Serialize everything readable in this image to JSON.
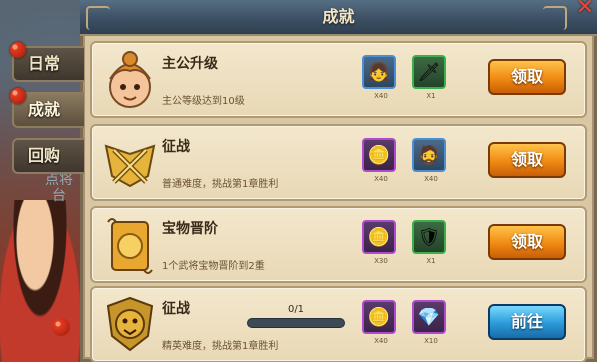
{
  "window": {
    "title": "成就",
    "close_glyph": "✕"
  },
  "tabs": [
    {
      "label": "日常",
      "badge": true
    },
    {
      "label": "成就",
      "badge": true,
      "active": true
    },
    {
      "label": "回购",
      "badge": false
    }
  ],
  "scene": {
    "sign_text": "点将台"
  },
  "achievements": [
    {
      "title": "主公升级",
      "desc": "主公等级达到10级",
      "icon": "lord-portrait-icon",
      "rewards": [
        {
          "icon": "hero-girl-card-icon",
          "glyph": "👧",
          "count": "X40"
        },
        {
          "icon": "sword-icon",
          "glyph": "🗡",
          "count": "X1"
        }
      ],
      "button": "领取",
      "button_style": "orange"
    },
    {
      "title": "征战",
      "desc": "普通难度，挑战第1章胜利",
      "icon": "crossed-swords-icon",
      "rewards": [
        {
          "icon": "gold-ingot-icon",
          "glyph": "🪙",
          "count": "X40"
        },
        {
          "icon": "hero-warrior-card-icon",
          "glyph": "🧔",
          "count": "X40"
        }
      ],
      "button": "领取",
      "button_style": "orange"
    },
    {
      "title": "宝物晋阶",
      "desc": "1个武将宝物晋阶到2重",
      "icon": "treasure-scroll-icon",
      "rewards": [
        {
          "icon": "gold-ingot-icon",
          "glyph": "🪙",
          "count": "X30"
        },
        {
          "icon": "armor-icon",
          "glyph": "🛡",
          "count": "X1"
        }
      ],
      "button": "领取",
      "button_style": "orange"
    },
    {
      "title": "征战",
      "desc": "精英难度，挑战第1章胜利",
      "icon": "beast-crest-icon",
      "progress": {
        "text": "0/1",
        "fraction": 0
      },
      "rewards": [
        {
          "icon": "gold-ingot-icon",
          "glyph": "🪙",
          "count": "X40"
        },
        {
          "icon": "green-gem-icon",
          "glyph": "💎",
          "count": "X10"
        }
      ],
      "button": "前往",
      "button_style": "blue"
    }
  ],
  "colors": {
    "frame": "#d9c7a3",
    "titlebar": "#3d5064",
    "button_orange": "#f08a12",
    "button_blue": "#2a9ad8"
  }
}
